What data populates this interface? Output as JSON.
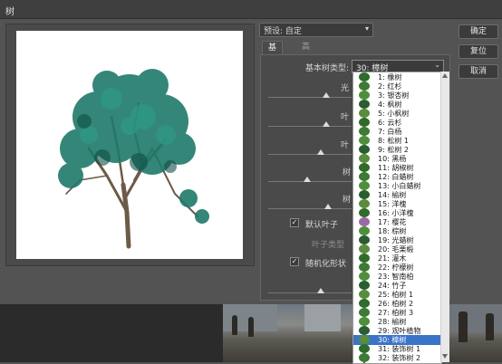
{
  "window": {
    "title": "树"
  },
  "preset": {
    "label": "预设: 自定"
  },
  "tabs": [
    {
      "label": "基本"
    },
    {
      "label": "高级"
    }
  ],
  "tree_type": {
    "label": "基本树类型:",
    "value": "30: 樟树"
  },
  "sliders": [
    {
      "label": "光"
    },
    {
      "label": "叶"
    },
    {
      "label": "叶"
    },
    {
      "label": "树"
    },
    {
      "label": "树"
    }
  ],
  "default_leaves": {
    "label": "默认叶子",
    "checked": true
  },
  "leaf_type": {
    "label": "叶子类型"
  },
  "randomize_shape": {
    "label": "随机化形状",
    "checked": true
  },
  "buttons": {
    "ok": "确定",
    "reset": "复位",
    "cancel": "取消"
  },
  "tree_list": [
    "1: 橡树",
    "2: 红杉",
    "3: 银杏树",
    "4: 枫树",
    "5: 小枫树",
    "6: 云杉",
    "7: 白杨",
    "8: 松树 1",
    "9: 松树 2",
    "10: 黑杨",
    "11: 胡椒树",
    "12: 白蜡树",
    "13: 小白蜡树",
    "14: 榆树",
    "15: 洋槐",
    "16: 小洋槐",
    "17: 樱花",
    "18: 棕树",
    "19: 光蜡树",
    "20: 毛栗椴",
    "21: 灌木",
    "22: 柠檬树",
    "23: 智南柏",
    "24: 竹子",
    "25: 柏树 1",
    "26: 柏树 2",
    "27: 柏树 3",
    "28: 榆树",
    "29: 观叶植物",
    "30: 樟树",
    "31: 装饰树 1",
    "32: 装饰树 2"
  ],
  "selected_tree_index": 29,
  "colors": {
    "accent": "#3a74c9",
    "foliage": "#1f7a6a",
    "trunk": "#6d5a48"
  }
}
